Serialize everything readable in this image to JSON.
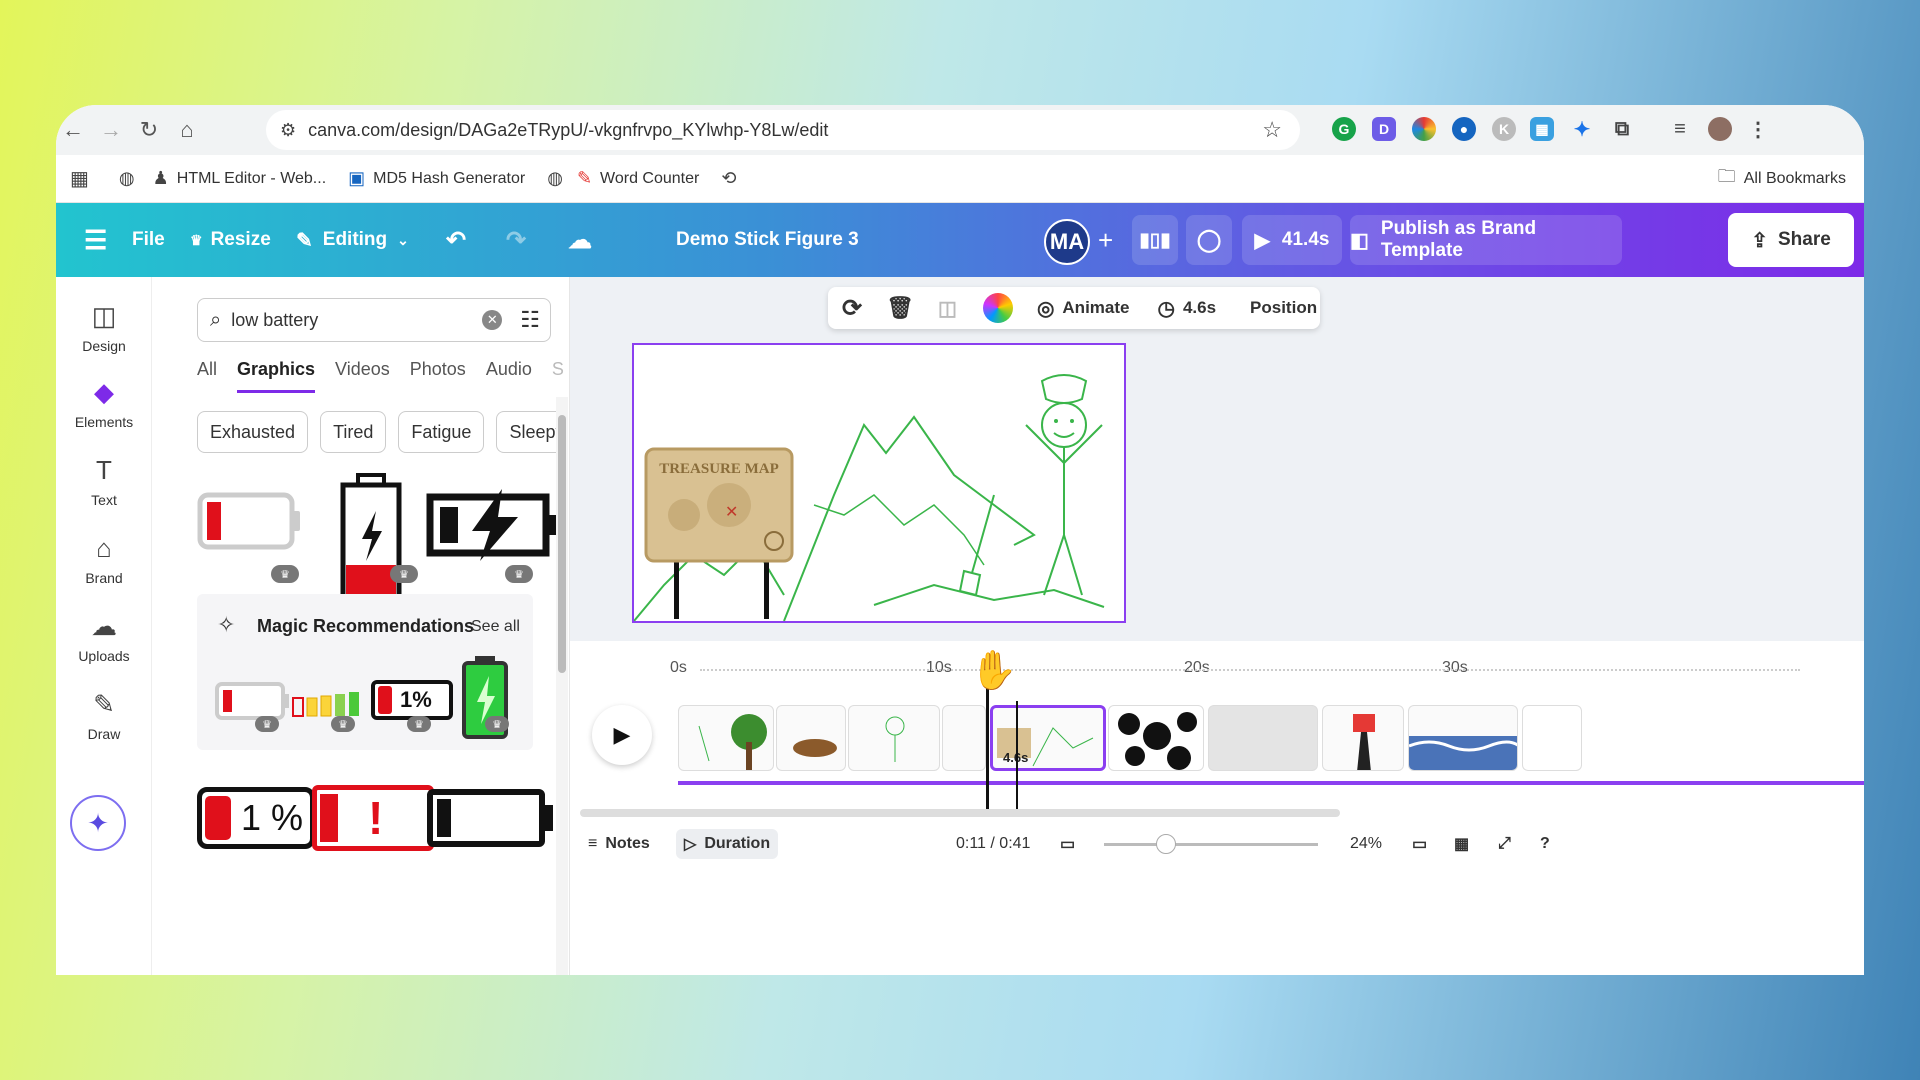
{
  "browser": {
    "url": "canva.com/design/DAGa2eTRypU/-vkgnfrvpo_KYlwhp-Y8Lw/edit",
    "bookmarks": [
      "HTML Editor - Web...",
      "MD5 Hash Generator",
      "Word Counter"
    ],
    "all_bookmarks": "All Bookmarks"
  },
  "toolbar": {
    "file": "File",
    "resize": "Resize",
    "editing": "Editing",
    "title": "Demo Stick Figure 3",
    "avatar": "MA",
    "duration": "41.4s",
    "publish": "Publish as Brand Template",
    "share": "Share"
  },
  "rail": [
    "Design",
    "Elements",
    "Text",
    "Brand",
    "Uploads",
    "Draw"
  ],
  "panel": {
    "search_value": "low battery",
    "tabs": [
      "All",
      "Graphics",
      "Videos",
      "Photos",
      "Audio",
      "S"
    ],
    "chips": [
      "Exhausted",
      "Tired",
      "Fatigue",
      "Sleepy"
    ],
    "magic_title": "Magic Recommendations",
    "see_all": "See all",
    "percent_label": "1%",
    "percent_label_big": "1 %",
    "exclaim": "!"
  },
  "context": {
    "animate": "Animate",
    "duration": "4.6s",
    "position": "Position"
  },
  "canvas": {
    "sign_text": "TREASURE MAP"
  },
  "timeline": {
    "ticks": [
      "0s",
      "10s",
      "20s",
      "30s"
    ],
    "selected_duration": "4.6s",
    "notes": "Notes",
    "duration_btn": "Duration",
    "time": "0:11 / 0:41",
    "zoom": "24%"
  },
  "colors": {
    "accent": "#7d2ae8",
    "battery_red": "#e0101b",
    "battery_green": "#2ecc40",
    "stroke_green": "#3ab54a"
  }
}
